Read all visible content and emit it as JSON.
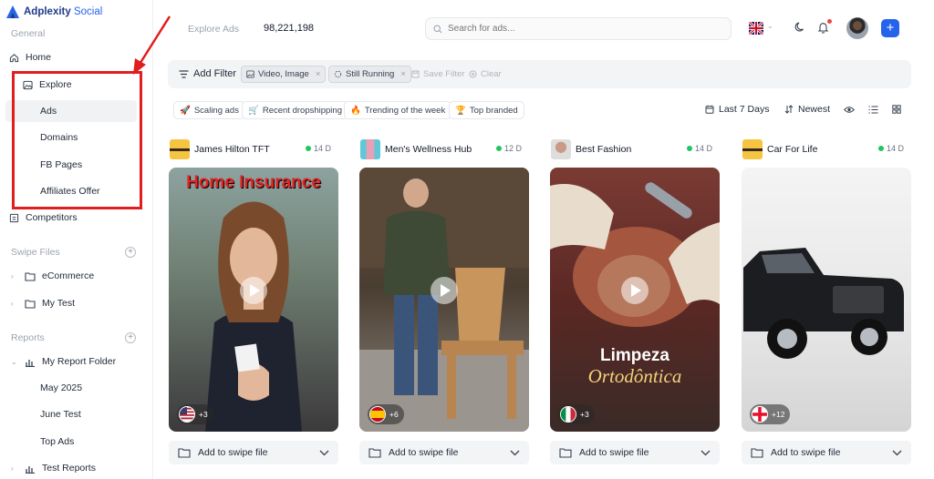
{
  "app": {
    "name": "Adplexity",
    "name_suffix": "Social",
    "brand_color": "#2563eb"
  },
  "sidebar": {
    "general_label": "General",
    "home": "Home",
    "explore": "Explore",
    "explore_items": [
      "Ads",
      "Domains",
      "FB Pages",
      "Affiliates Offer"
    ],
    "competitors": "Competitors",
    "swipe_files_label": "Swipe Files",
    "swipe_files": [
      "eCommerce",
      "My Test"
    ],
    "reports_label": "Reports",
    "report_folder": "My Report Folder",
    "report_items": [
      "May 2025",
      "June Test",
      "Top Ads"
    ],
    "test_reports": "Test Reports"
  },
  "header": {
    "breadcrumb": "Explore Ads",
    "total_count": "98,221,198",
    "search_placeholder": "Search for ads..."
  },
  "filters": {
    "add_filter": "Add Filter",
    "chips": [
      "Video, Image",
      "Still Running"
    ],
    "save_filter": "Save Filter",
    "clear": "Clear"
  },
  "tags": [
    "Scaling ads",
    "Recent dropshipping",
    "Trending of the week",
    "Top branded"
  ],
  "sort": {
    "range": "Last 7 Days",
    "order": "Newest"
  },
  "cards": [
    {
      "name": "James Hilton TFT",
      "age": "14 D",
      "overlay": "Home Insurance",
      "geo_more": "+3",
      "swipe": "Add to swipe file"
    },
    {
      "name": "Men's Wellness Hub",
      "age": "12 D",
      "overlay": "",
      "geo_more": "+6",
      "swipe": "Add to swipe file"
    },
    {
      "name": "Best Fashion",
      "age": "14 D",
      "overlay": "Limpeza",
      "overlay2": "Ortodôntica",
      "geo_more": "+3",
      "swipe": "Add to swipe file"
    },
    {
      "name": "Car For Life",
      "age": "14 D",
      "overlay": "",
      "geo_more": "+12",
      "swipe": "Add to swipe file"
    }
  ]
}
